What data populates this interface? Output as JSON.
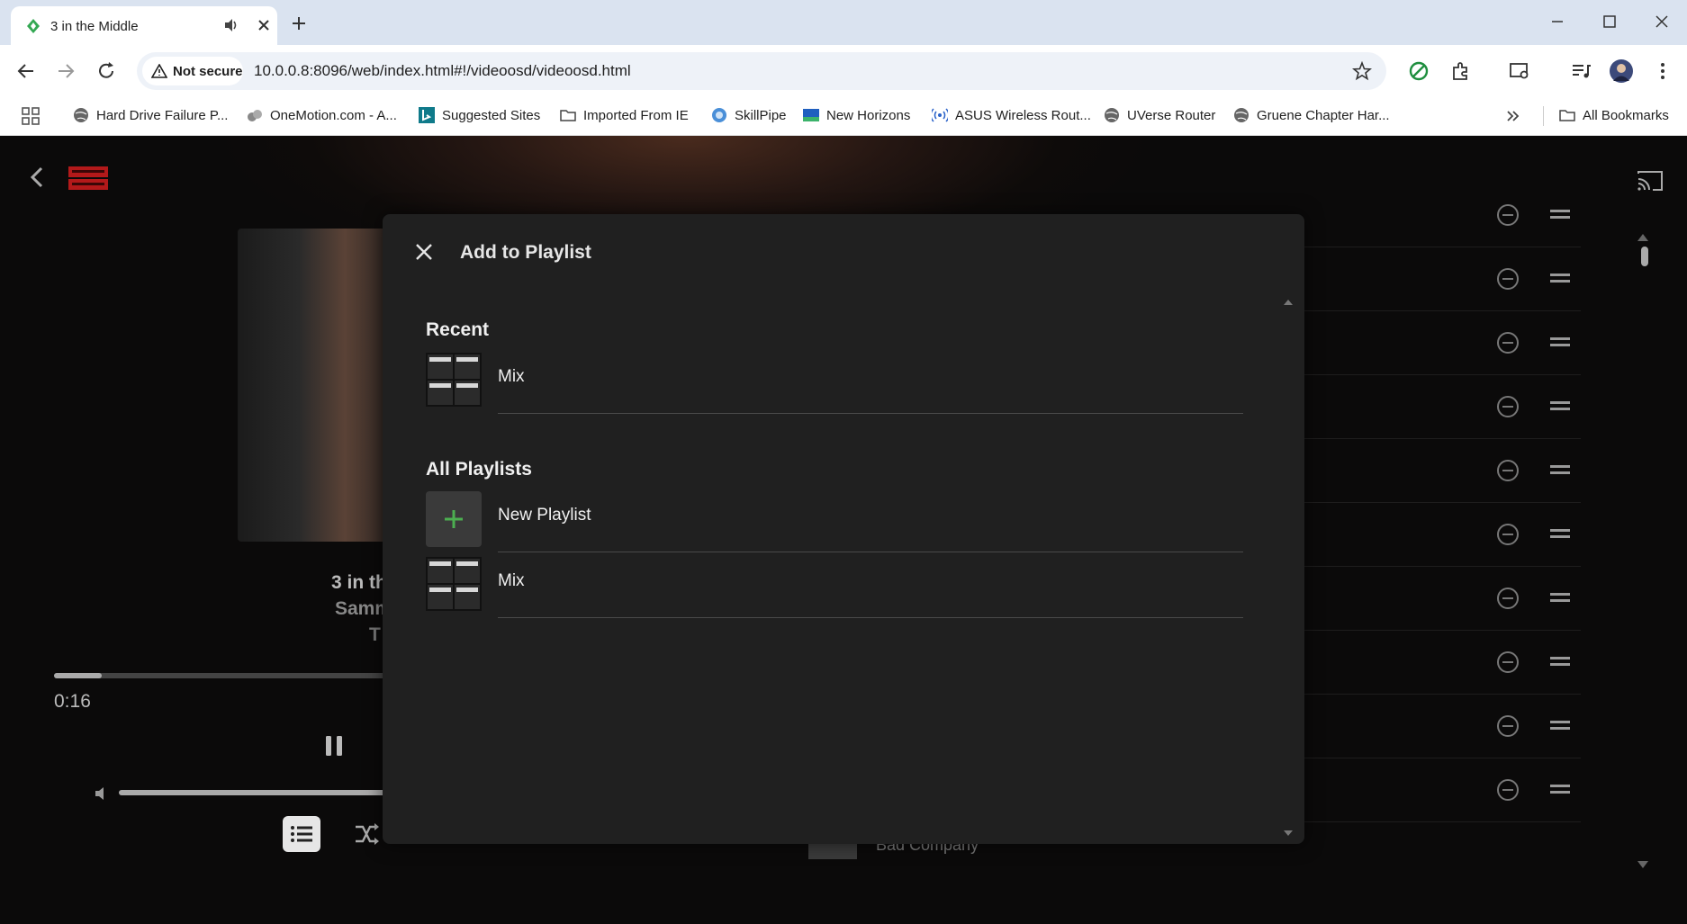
{
  "browser": {
    "tab_title": "3 in the Middle",
    "security_label": "Not secure",
    "url": "10.0.0.8:8096/web/index.html#!/videoosd/videoosd.html",
    "bookmarks": [
      {
        "label": "Hard Drive Failure P...",
        "icon": "globe-icon"
      },
      {
        "label": "OneMotion.com - A...",
        "icon": "site-icon"
      },
      {
        "label": "Suggested Sites",
        "icon": "bing-icon"
      },
      {
        "label": "Imported From IE",
        "icon": "folder-icon"
      },
      {
        "label": "SkillPipe",
        "icon": "site-icon"
      },
      {
        "label": "New Horizons",
        "icon": "site-icon"
      },
      {
        "label": "ASUS Wireless Rout...",
        "icon": "wireless-icon"
      },
      {
        "label": "UVerse Router",
        "icon": "globe-icon"
      },
      {
        "label": "Gruene Chapter Har...",
        "icon": "globe-icon"
      }
    ],
    "all_bookmarks": "All Bookmarks"
  },
  "player": {
    "track_title": "3 in th",
    "artist": "Samm",
    "album": "T",
    "elapsed": "0:16",
    "progress_fraction": 0.14,
    "volume_fraction": 1.0,
    "queue_last_artist": "Bad Company"
  },
  "dialog": {
    "title": "Add to Playlist",
    "recent_heading": "Recent",
    "recent_items": [
      {
        "label": "Mix"
      }
    ],
    "all_heading": "All Playlists",
    "new_playlist_label": "New Playlist",
    "all_items": [
      {
        "label": "Mix"
      }
    ]
  },
  "colors": {
    "accent_green": "#4caf50",
    "dialog_bg": "#202020",
    "chrome_tab_strip": "#dae3f0"
  }
}
